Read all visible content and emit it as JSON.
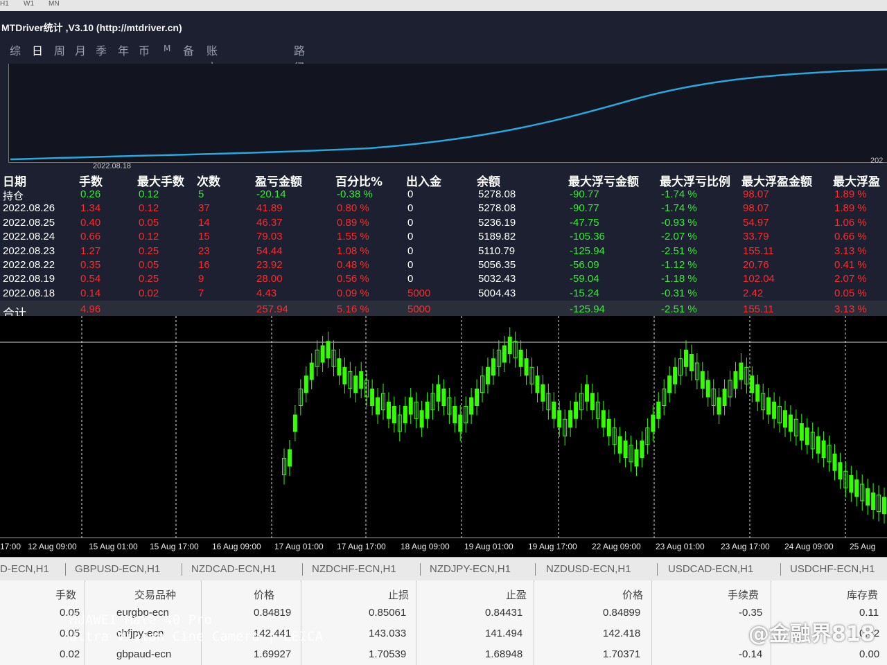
{
  "timeframes": [
    "H1",
    "W1",
    "MN"
  ],
  "app": {
    "title": "MTDriver统计 ,V3.10 (http://mtdriver.cn)"
  },
  "tabs": [
    "综",
    "日",
    "周",
    "月",
    "季",
    "年",
    "币",
    "M",
    "备",
    "账户",
    "路径"
  ],
  "equity": {
    "date_label": "2022.08.18",
    "year_label": "202",
    "line_color": "#29a8e0"
  },
  "stats": {
    "headers": [
      "日期",
      "手数",
      "最大手数",
      "次数",
      "盈亏金额",
      "百分比%",
      "出入金",
      "余额",
      "最大浮亏金额",
      "最大浮亏比例",
      "最大浮盈金额",
      "最大浮盈"
    ],
    "rows": [
      [
        "持仓",
        "0.26",
        "0.12",
        "5",
        "-20.14",
        "-0.38 %",
        "0",
        "5278.08",
        "-90.77",
        "-1.74 %",
        "98.07",
        "1.89 %"
      ],
      [
        "2022.08.26",
        "1.34",
        "0.12",
        "37",
        "41.89",
        "0.80 %",
        "0",
        "5278.08",
        "-90.77",
        "-1.74 %",
        "98.07",
        "1.89 %"
      ],
      [
        "2022.08.25",
        "0.40",
        "0.05",
        "14",
        "46.37",
        "0.89 %",
        "0",
        "5236.19",
        "-47.75",
        "-0.93 %",
        "54.97",
        "1.06 %"
      ],
      [
        "2022.08.24",
        "0.66",
        "0.12",
        "15",
        "79.03",
        "1.55 %",
        "0",
        "5189.82",
        "-105.36",
        "-2.07 %",
        "33.79",
        "0.66 %"
      ],
      [
        "2022.08.23",
        "1.27",
        "0.25",
        "23",
        "54.44",
        "1.08 %",
        "0",
        "5110.79",
        "-125.94",
        "-2.51 %",
        "155.11",
        "3.13 %"
      ],
      [
        "2022.08.22",
        "0.35",
        "0.05",
        "16",
        "23.92",
        "0.48 %",
        "0",
        "5056.35",
        "-56.09",
        "-1.12 %",
        "20.76",
        "0.41 %"
      ],
      [
        "2022.08.19",
        "0.54",
        "0.25",
        "9",
        "28.00",
        "0.56 %",
        "0",
        "5032.43",
        "-59.04",
        "-1.18 %",
        "102.04",
        "2.07 %"
      ],
      [
        "2022.08.18",
        "0.14",
        "0.02",
        "7",
        "4.43",
        "0.09 %",
        "5000",
        "5004.43",
        "-15.24",
        "-0.31 %",
        "2.42",
        "0.05 %"
      ]
    ],
    "total": [
      "合计",
      "4.96",
      "",
      "",
      "257.94",
      "5.16 %",
      "5000",
      "",
      "-125.94",
      "-2.51 %",
      "155.11",
      "3.13 %"
    ]
  },
  "chart_data": {
    "type": "candlestick",
    "x_labels": [
      "17:00",
      "12 Aug 09:00",
      "15 Aug 01:00",
      "15 Aug 17:00",
      "16 Aug 09:00",
      "17 Aug 01:00",
      "17 Aug 17:00",
      "18 Aug 09:00",
      "19 Aug 01:00",
      "19 Aug 17:00",
      "22 Aug 09:00",
      "23 Aug 01:00",
      "23 Aug 17:00",
      "24 Aug 09:00",
      "25 Aug"
    ],
    "candle_color": "#33ff00",
    "series": [
      {
        "values": [
          20,
          24,
          40,
          52,
          58,
          64,
          70,
          72,
          74,
          70,
          66,
          62,
          60,
          58,
          60,
          56,
          52,
          48,
          50,
          46,
          44,
          40,
          44,
          48,
          46,
          42,
          46,
          50,
          54,
          52,
          48,
          44,
          40,
          44,
          48,
          52,
          58,
          62,
          66,
          70,
          72,
          76,
          74,
          70,
          66,
          62,
          58,
          54,
          50,
          46,
          42,
          38,
          42,
          46,
          50,
          54,
          50,
          46,
          42,
          38,
          34,
          30,
          28,
          26,
          24,
          28,
          34,
          40,
          46,
          52,
          58,
          62,
          66,
          70,
          68,
          64,
          60,
          56,
          52,
          48,
          52,
          56,
          60,
          64,
          62,
          58,
          54,
          50,
          48,
          46,
          44,
          42,
          40,
          38,
          36,
          34,
          32,
          30,
          28,
          26,
          22,
          18,
          14,
          12,
          10,
          8,
          6,
          4,
          3,
          2
        ]
      }
    ]
  },
  "symbols": [
    "D-ECN,H1",
    "GBPUSD-ECN,H1",
    "NZDCAD-ECN,H1",
    "NZDCHF-ECN,H1",
    "NZDJPY-ECN,H1",
    "NZDUSD-ECN,H1",
    "USDCAD-ECN,H1",
    "USDCHF-ECN,H1"
  ],
  "orders": {
    "headers": [
      "手数",
      "交易品种",
      "价格",
      "止损",
      "止盈",
      "价格",
      "手续费",
      "库存费"
    ],
    "rows": [
      [
        "0.05",
        "eurgbp-ecn",
        "0.84819",
        "0.85061",
        "0.84431",
        "0.84899",
        "-0.35",
        "0.11"
      ],
      [
        "0.05",
        "chfjpy-ecn",
        "142.441",
        "143.033",
        "141.494",
        "142.418",
        "",
        "0.42"
      ],
      [
        "0.02",
        "gbpaud-ecn",
        "1.69927",
        "1.70539",
        "1.68948",
        "1.70371",
        "-0.14",
        "0.00"
      ]
    ]
  },
  "watermark": {
    "camera_line1": "HUAWEI Mate 40 Pro",
    "camera_line2": "Ultra Vision Cine Camera | LEICA",
    "source": "@金融界818"
  }
}
